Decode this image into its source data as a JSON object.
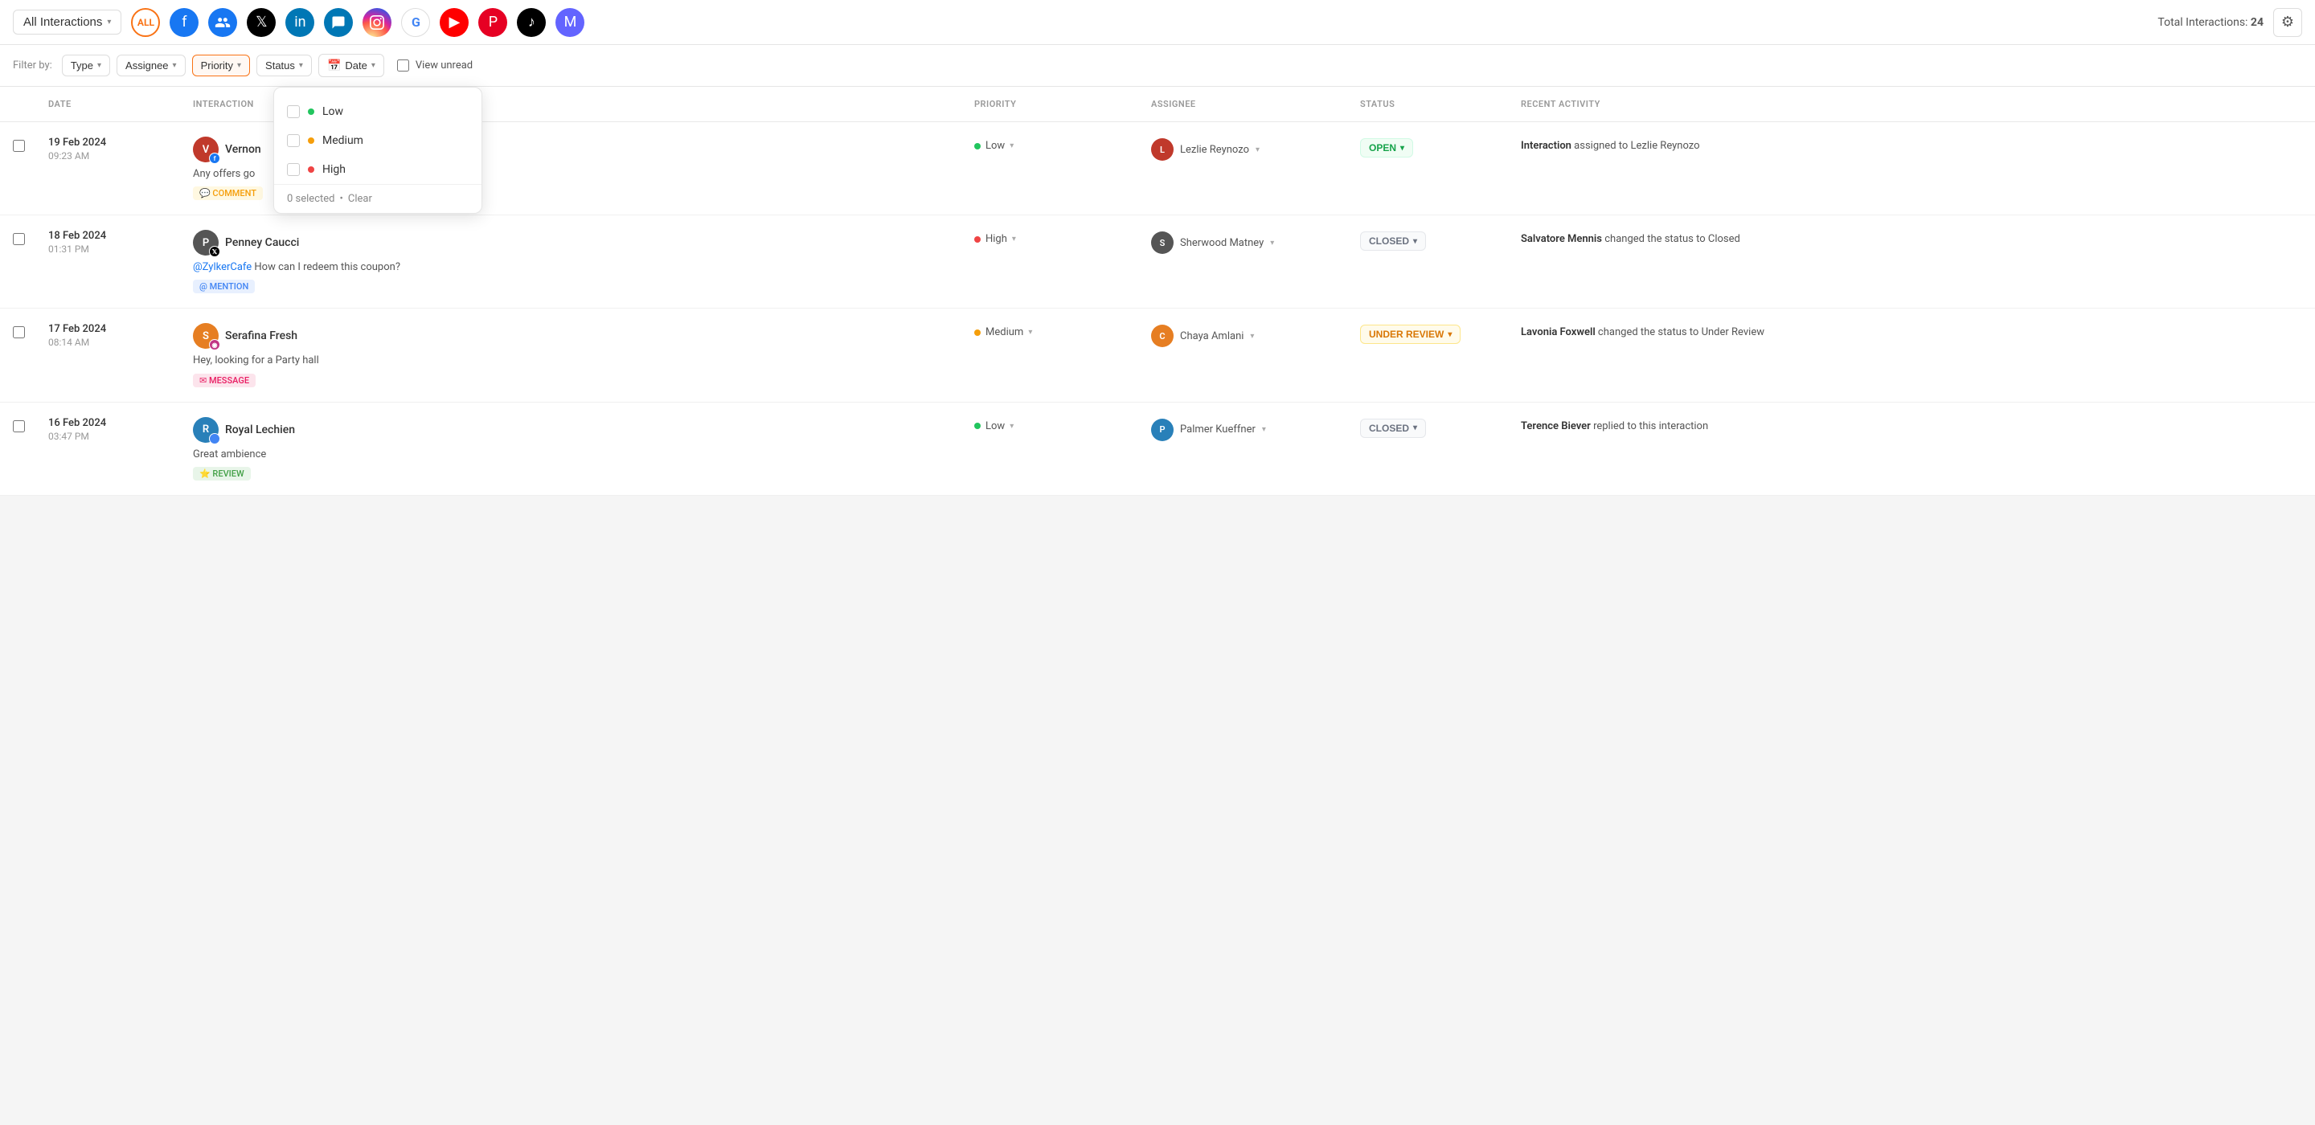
{
  "topNav": {
    "allInteractions": "All Interactions",
    "totalLabel": "Total Interactions:",
    "totalCount": "24",
    "settingsIcon": "⚙"
  },
  "filters": {
    "filterByLabel": "Filter by:",
    "type": "Type",
    "assignee": "Assignee",
    "priority": "Priority",
    "status": "Status",
    "date": "Date",
    "viewUnread": "View unread"
  },
  "priorityDropdown": {
    "options": [
      {
        "id": "low",
        "label": "Low",
        "dotClass": "low"
      },
      {
        "id": "medium",
        "label": "Medium",
        "dotClass": "medium"
      },
      {
        "id": "high",
        "label": "High",
        "dotClass": "high"
      }
    ],
    "selectedCount": "0 selected",
    "clearLabel": "Clear"
  },
  "tableHeaders": {
    "date": "DATE",
    "interaction": "INTERACTION",
    "priority": "PRIORITY",
    "assignee": "ASSIGNEE",
    "status": "STATUS",
    "recentActivity": "RECENT ACTIVITY"
  },
  "rows": [
    {
      "date": "19 Feb 2024",
      "time": "09:23 AM",
      "avatarInitials": "V",
      "avatarClass": "av-lezlie",
      "badgeClass": "fb",
      "badgeIcon": "f",
      "userName": "Vernon",
      "interactionText": "Any offers go",
      "tagType": "comment",
      "tagLabel": "COMMENT",
      "priority": "Low",
      "priorityDot": "low",
      "assigneeInitials": "L",
      "assigneeAvatarClass": "av-lezlie",
      "assigneeName": "Lezlie Reynozo",
      "statusClass": "open",
      "statusLabel": "OPEN",
      "activityText": "Interaction assigned to Lezlie Reynozo",
      "activityBold": "Interaction"
    },
    {
      "date": "18 Feb 2024",
      "time": "01:31 PM",
      "avatarInitials": "P",
      "avatarClass": "av-sherwood",
      "badgeClass": "tw",
      "badgeIcon": "𝕏",
      "userName": "Penney Caucci",
      "interactionTextMention": "@ZylkerCafe",
      "interactionText": " How can I redeem this coupon?",
      "tagType": "mention",
      "tagLabel": "MENTION",
      "priority": "High",
      "priorityDot": "high",
      "assigneeInitials": "S",
      "assigneeAvatarClass": "av-sherwood",
      "assigneeName": "Sherwood Matney",
      "statusClass": "closed",
      "statusLabel": "CLOSED",
      "activityText": "Salvatore Mennis changed the status to Closed",
      "activityBold": "Salvatore Mennis"
    },
    {
      "date": "17 Feb 2024",
      "time": "08:14 AM",
      "avatarInitials": "S",
      "avatarClass": "av-chaya",
      "badgeClass": "ig",
      "badgeIcon": "◉",
      "userName": "Serafina Fresh",
      "interactionText": "Hey, looking for a Party hall",
      "tagType": "message",
      "tagLabel": "MESSAGE",
      "priority": "Medium",
      "priorityDot": "medium",
      "assigneeInitials": "C",
      "assigneeAvatarClass": "av-chaya",
      "assigneeName": "Chaya Amlani",
      "statusClass": "under-review",
      "statusLabel": "UNDER REVIEW",
      "activityText": "Lavonia Foxwell changed the status to Under Review",
      "activityBold": "Lavonia Foxwell"
    },
    {
      "date": "16 Feb 2024",
      "time": "03:47 PM",
      "avatarInitials": "R",
      "avatarClass": "av-palmer",
      "badgeClass": "gg",
      "badgeIcon": "G",
      "userName": "Royal Lechien",
      "interactionText": "Great ambience",
      "tagType": "review",
      "tagLabel": "REVIEW",
      "priority": "Low",
      "priorityDot": "low",
      "assigneeInitials": "P",
      "assigneeAvatarClass": "av-palmer",
      "assigneeName": "Palmer Kueffner",
      "statusClass": "closed",
      "statusLabel": "CLOSED",
      "activityText": "Terence Biever replied to this interaction",
      "activityBold": "Terence Biever"
    }
  ]
}
